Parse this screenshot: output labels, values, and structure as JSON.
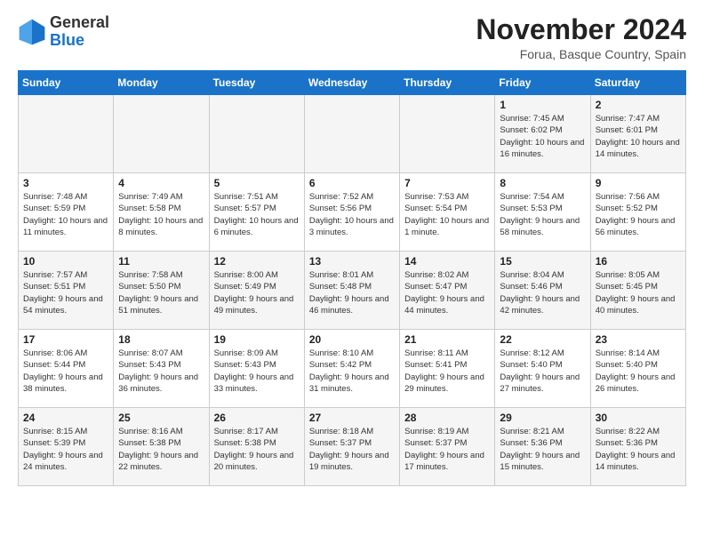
{
  "logo": {
    "general": "General",
    "blue": "Blue"
  },
  "header": {
    "month_year": "November 2024",
    "location": "Forua, Basque Country, Spain"
  },
  "weekdays": [
    "Sunday",
    "Monday",
    "Tuesday",
    "Wednesday",
    "Thursday",
    "Friday",
    "Saturday"
  ],
  "weeks": [
    [
      {
        "day": "",
        "info": ""
      },
      {
        "day": "",
        "info": ""
      },
      {
        "day": "",
        "info": ""
      },
      {
        "day": "",
        "info": ""
      },
      {
        "day": "",
        "info": ""
      },
      {
        "day": "1",
        "info": "Sunrise: 7:45 AM\nSunset: 6:02 PM\nDaylight: 10 hours and 16 minutes."
      },
      {
        "day": "2",
        "info": "Sunrise: 7:47 AM\nSunset: 6:01 PM\nDaylight: 10 hours and 14 minutes."
      }
    ],
    [
      {
        "day": "3",
        "info": "Sunrise: 7:48 AM\nSunset: 5:59 PM\nDaylight: 10 hours and 11 minutes."
      },
      {
        "day": "4",
        "info": "Sunrise: 7:49 AM\nSunset: 5:58 PM\nDaylight: 10 hours and 8 minutes."
      },
      {
        "day": "5",
        "info": "Sunrise: 7:51 AM\nSunset: 5:57 PM\nDaylight: 10 hours and 6 minutes."
      },
      {
        "day": "6",
        "info": "Sunrise: 7:52 AM\nSunset: 5:56 PM\nDaylight: 10 hours and 3 minutes."
      },
      {
        "day": "7",
        "info": "Sunrise: 7:53 AM\nSunset: 5:54 PM\nDaylight: 10 hours and 1 minute."
      },
      {
        "day": "8",
        "info": "Sunrise: 7:54 AM\nSunset: 5:53 PM\nDaylight: 9 hours and 58 minutes."
      },
      {
        "day": "9",
        "info": "Sunrise: 7:56 AM\nSunset: 5:52 PM\nDaylight: 9 hours and 56 minutes."
      }
    ],
    [
      {
        "day": "10",
        "info": "Sunrise: 7:57 AM\nSunset: 5:51 PM\nDaylight: 9 hours and 54 minutes."
      },
      {
        "day": "11",
        "info": "Sunrise: 7:58 AM\nSunset: 5:50 PM\nDaylight: 9 hours and 51 minutes."
      },
      {
        "day": "12",
        "info": "Sunrise: 8:00 AM\nSunset: 5:49 PM\nDaylight: 9 hours and 49 minutes."
      },
      {
        "day": "13",
        "info": "Sunrise: 8:01 AM\nSunset: 5:48 PM\nDaylight: 9 hours and 46 minutes."
      },
      {
        "day": "14",
        "info": "Sunrise: 8:02 AM\nSunset: 5:47 PM\nDaylight: 9 hours and 44 minutes."
      },
      {
        "day": "15",
        "info": "Sunrise: 8:04 AM\nSunset: 5:46 PM\nDaylight: 9 hours and 42 minutes."
      },
      {
        "day": "16",
        "info": "Sunrise: 8:05 AM\nSunset: 5:45 PM\nDaylight: 9 hours and 40 minutes."
      }
    ],
    [
      {
        "day": "17",
        "info": "Sunrise: 8:06 AM\nSunset: 5:44 PM\nDaylight: 9 hours and 38 minutes."
      },
      {
        "day": "18",
        "info": "Sunrise: 8:07 AM\nSunset: 5:43 PM\nDaylight: 9 hours and 36 minutes."
      },
      {
        "day": "19",
        "info": "Sunrise: 8:09 AM\nSunset: 5:43 PM\nDaylight: 9 hours and 33 minutes."
      },
      {
        "day": "20",
        "info": "Sunrise: 8:10 AM\nSunset: 5:42 PM\nDaylight: 9 hours and 31 minutes."
      },
      {
        "day": "21",
        "info": "Sunrise: 8:11 AM\nSunset: 5:41 PM\nDaylight: 9 hours and 29 minutes."
      },
      {
        "day": "22",
        "info": "Sunrise: 8:12 AM\nSunset: 5:40 PM\nDaylight: 9 hours and 27 minutes."
      },
      {
        "day": "23",
        "info": "Sunrise: 8:14 AM\nSunset: 5:40 PM\nDaylight: 9 hours and 26 minutes."
      }
    ],
    [
      {
        "day": "24",
        "info": "Sunrise: 8:15 AM\nSunset: 5:39 PM\nDaylight: 9 hours and 24 minutes."
      },
      {
        "day": "25",
        "info": "Sunrise: 8:16 AM\nSunset: 5:38 PM\nDaylight: 9 hours and 22 minutes."
      },
      {
        "day": "26",
        "info": "Sunrise: 8:17 AM\nSunset: 5:38 PM\nDaylight: 9 hours and 20 minutes."
      },
      {
        "day": "27",
        "info": "Sunrise: 8:18 AM\nSunset: 5:37 PM\nDaylight: 9 hours and 19 minutes."
      },
      {
        "day": "28",
        "info": "Sunrise: 8:19 AM\nSunset: 5:37 PM\nDaylight: 9 hours and 17 minutes."
      },
      {
        "day": "29",
        "info": "Sunrise: 8:21 AM\nSunset: 5:36 PM\nDaylight: 9 hours and 15 minutes."
      },
      {
        "day": "30",
        "info": "Sunrise: 8:22 AM\nSunset: 5:36 PM\nDaylight: 9 hours and 14 minutes."
      }
    ]
  ]
}
